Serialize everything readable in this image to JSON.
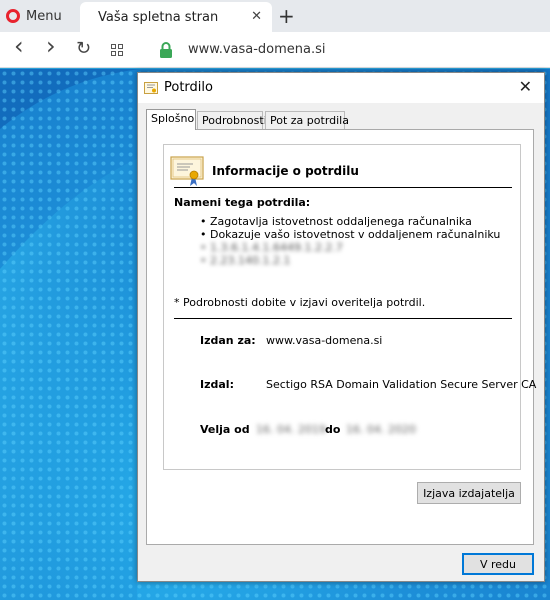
{
  "browser": {
    "menu_label": "Menu",
    "tab_title": "Vaša spletna stran",
    "tab_close": "✕",
    "new_tab": "+",
    "url": "www.vasa-domena.si",
    "nav": {
      "back": "‹",
      "forward": "›",
      "reload": "↻"
    }
  },
  "dialog": {
    "title": "Potrdilo",
    "close": "✕",
    "tabs": [
      "Splošno",
      "Podrobnosti",
      "Pot za potrdila"
    ],
    "info_title": "Informacije o potrdilu",
    "purposes_title": "Nameni tega potrdila:",
    "purposes": [
      "• Zagotavlja istovetnost oddaljenega računalnika",
      "• Dokazuje vašo istovetnost v oddaljenem računalniku",
      "• 1.3.6.1.4.1.6449.1.2.2.7",
      "• 2.23.140.1.2.1"
    ],
    "note": "* Podrobnosti dobite v izjavi overitelja potrdil.",
    "issued_to_label": "Izdan za:",
    "issued_to_value": "www.vasa-domena.si",
    "issued_by_label": "Izdal:",
    "issued_by_value": "Sectigo RSA Domain Validation Secure Server CA",
    "valid_from_label": "Velja od",
    "valid_from_value": "16. 04. 2019",
    "valid_to_label": "do",
    "valid_to_value": "16. 04. 2020",
    "issuer_statement_button": "Izjava izdajatelja",
    "ok_button": "V redu"
  },
  "colors": {
    "accent": "#0078d7",
    "opera_red": "#e8232e",
    "lock_green": "#3aa757",
    "desktop": "#1d8fd8"
  }
}
